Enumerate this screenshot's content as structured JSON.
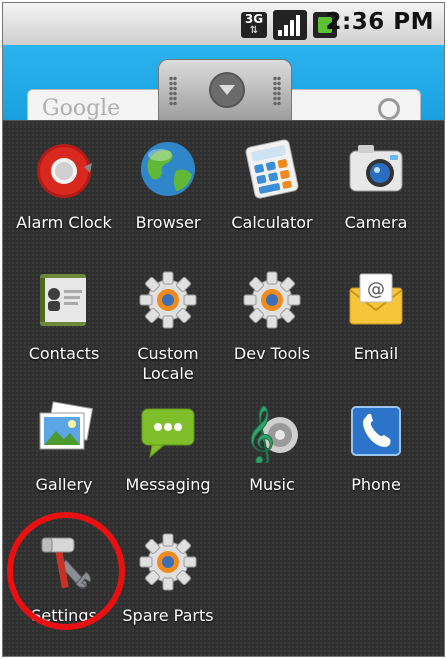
{
  "status_bar": {
    "network": "3G",
    "time": "2:36 PM",
    "icons": [
      "3g-icon",
      "signal-icon",
      "battery-icon"
    ]
  },
  "home": {
    "search_text": "Google"
  },
  "apps": [
    {
      "label": "Alarm Clock",
      "icon": "alarm-clock-icon"
    },
    {
      "label": "Browser",
      "icon": "globe-icon"
    },
    {
      "label": "Calculator",
      "icon": "calculator-icon"
    },
    {
      "label": "Camera",
      "icon": "camera-icon"
    },
    {
      "label": "Contacts",
      "icon": "contacts-icon"
    },
    {
      "label": "Custom Locale",
      "icon": "gear-icon"
    },
    {
      "label": "Dev Tools",
      "icon": "gear-icon"
    },
    {
      "label": "Email",
      "icon": "envelope-icon"
    },
    {
      "label": "Gallery",
      "icon": "photos-icon"
    },
    {
      "label": "Messaging",
      "icon": "speech-bubble-icon"
    },
    {
      "label": "Music",
      "icon": "treble-clef-icon"
    },
    {
      "label": "Phone",
      "icon": "phone-handset-icon"
    },
    {
      "label": "Settings",
      "icon": "hammer-wrench-icon"
    },
    {
      "label": "Spare Parts",
      "icon": "gear-icon"
    }
  ],
  "colors": {
    "highlight_ring": "#e81010",
    "home_background": "#1aa0e0",
    "drawer_background": "#2f2f2f"
  }
}
